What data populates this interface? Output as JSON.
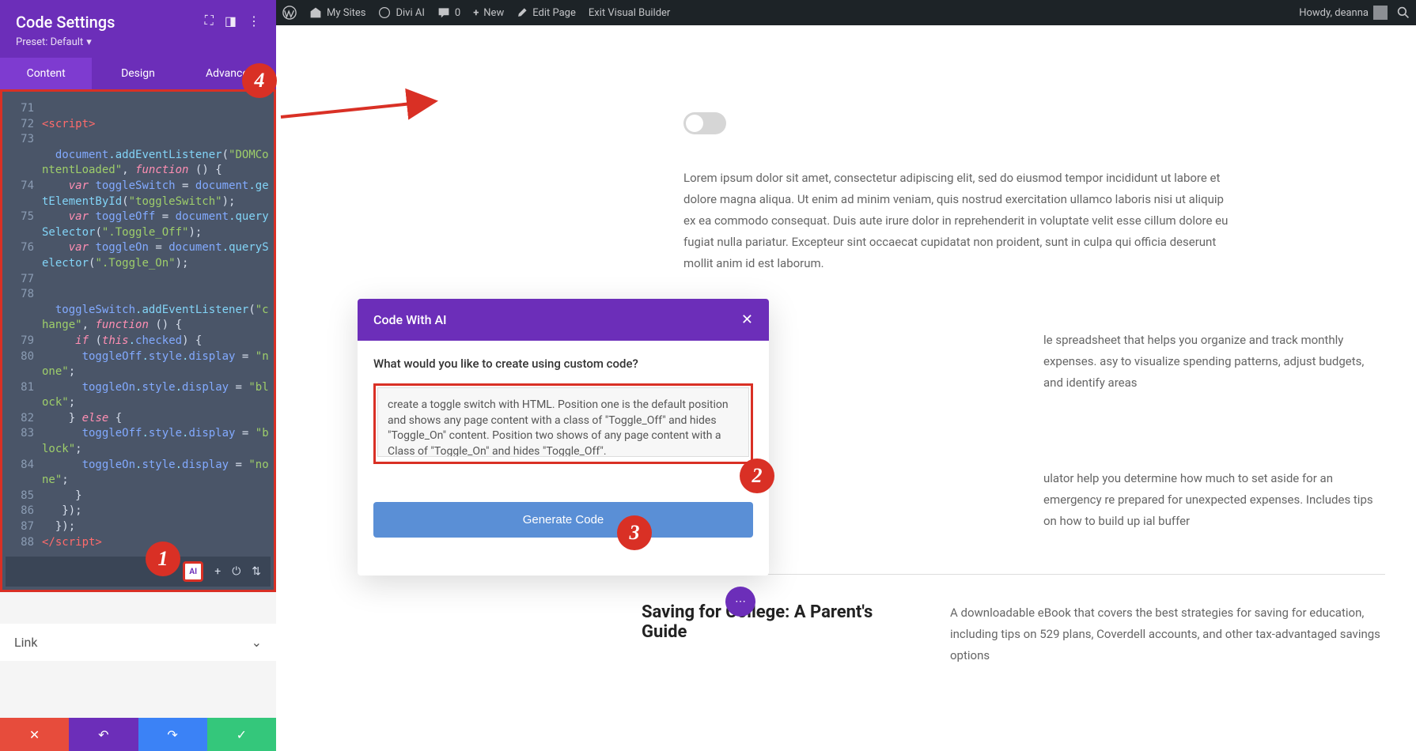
{
  "adminBar": {
    "mySites": "My Sites",
    "diviAI": "Divi AI",
    "comments": "0",
    "new": "New",
    "editPage": "Edit Page",
    "exitBuilder": "Exit Visual Builder",
    "howdy": "Howdy, deanna"
  },
  "panel": {
    "title": "Code Settings",
    "preset": "Preset: Default",
    "tabs": {
      "content": "Content",
      "design": "Design",
      "advanced": "Advanced"
    }
  },
  "code": {
    "lines": [
      {
        "n": "71",
        "c": ""
      },
      {
        "n": "72",
        "c": "<script>"
      },
      {
        "n": "73",
        "c": ""
      },
      {
        "n": "",
        "c": "  document.addEventListener(\"DOMContentLoaded\", function () {"
      },
      {
        "n": "74",
        "c": "    var toggleSwitch = document.getElementById(\"toggleSwitch\");"
      },
      {
        "n": "75",
        "c": "    var toggleOff = document.querySelector(\".Toggle_Off\");"
      },
      {
        "n": "76",
        "c": "    var toggleOn = document.querySelector(\".Toggle_On\");"
      },
      {
        "n": "77",
        "c": ""
      },
      {
        "n": "78",
        "c": ""
      },
      {
        "n": "",
        "c": "  toggleSwitch.addEventListener(\"change\", function () {"
      },
      {
        "n": "79",
        "c": "     if (this.checked) {"
      },
      {
        "n": "80",
        "c": "      toggleOff.style.display = \"none\";"
      },
      {
        "n": "81",
        "c": "      toggleOn.style.display = \"block\";"
      },
      {
        "n": "82",
        "c": "    } else {"
      },
      {
        "n": "83",
        "c": "      toggleOff.style.display = \"block\";"
      },
      {
        "n": "84",
        "c": "      toggleOn.style.display = \"none\";"
      },
      {
        "n": "85",
        "c": "     }"
      },
      {
        "n": "86",
        "c": "   });"
      },
      {
        "n": "87",
        "c": "  });"
      },
      {
        "n": "88",
        "c": "</script>"
      }
    ]
  },
  "aiBadge": "AI",
  "linkLabel": "Link",
  "lorem": "Lorem ipsum dolor sit amet, consectetur adipiscing elit, sed do eiusmod tempor incididunt ut labore et dolore magna aliqua. Ut enim ad minim veniam, quis nostrud exercitation ullamco laboris nisi ut aliquip ex ea commodo consequat. Duis aute irure dolor in reprehenderit in voluptate velit esse cillum dolore eu fugiat nulla pariatur. Excepteur sint occaecat cupidatat non proident, sunt in culpa qui officia deserunt mollit anim id est laborum.",
  "aiModal": {
    "title": "Code With AI",
    "promptLabel": "What would you like to create using custom code?",
    "textarea": "create a toggle switch with HTML. Position one is the default position and shows any page content with a class of \"Toggle_Off\" and hides \"Toggle_On\" content. Position two shows of any page content with a Class of \"Toggle_On\" and hides \"Toggle_Off\".",
    "generate": "Generate Code"
  },
  "bgText1": "le spreadsheet that helps you organize and track monthly expenses. asy to visualize spending patterns, adjust budgets, and identify areas",
  "bgText2": "ulator help you determine how much to set aside for an emergency re prepared for unexpected expenses. Includes tips on how to build up ial buffer",
  "section3": {
    "title": "Saving for College: A Parent's Guide",
    "body": "A downloadable eBook that covers the best strategies for saving for education, including tips on 529 plans, Coverdell accounts, and other tax-advantaged savings options"
  },
  "callouts": {
    "c1": "1",
    "c2": "2",
    "c3": "3",
    "c4": "4"
  }
}
